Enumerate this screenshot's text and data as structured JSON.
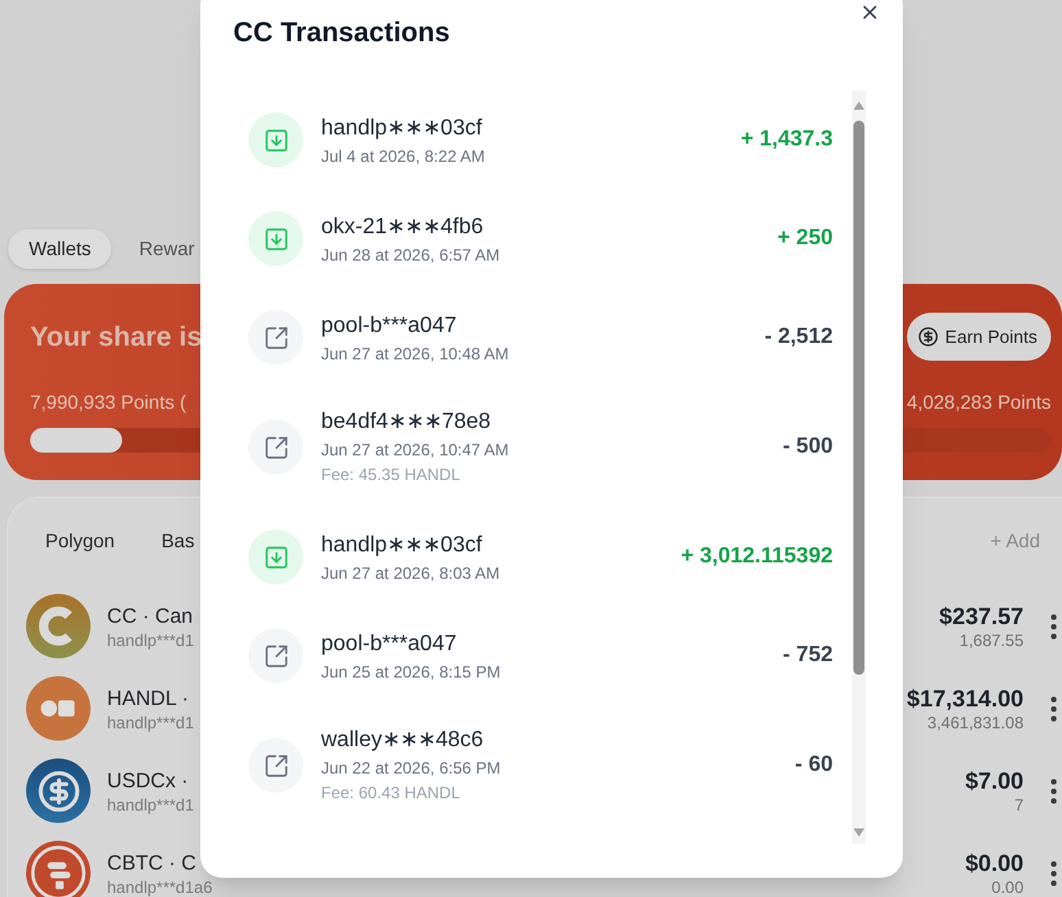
{
  "tabs": [
    {
      "label": "Wallets",
      "selected": true
    },
    {
      "label": "Rewar",
      "selected": false
    }
  ],
  "share_card": {
    "headline": "Your share is",
    "earn_button": "Earn Points",
    "points_left": "7,990,933 Points (",
    "points_right": "4,028,283 Points",
    "level": 0.09
  },
  "assets": {
    "networks": [
      "Polygon",
      "Bas"
    ],
    "add_button": "+ Add",
    "tokens": [
      {
        "kind": "cc",
        "name": "CC · Can",
        "address": "handlp***d1",
        "value": "$237.57",
        "balance": "1,687.55"
      },
      {
        "kind": "handl",
        "name": "HANDL ·",
        "address": "handlp***d1",
        "value": "$17,314.00",
        "balance": "3,461,831.08"
      },
      {
        "kind": "usdcx",
        "name": "USDCx ·",
        "address": "handlp***d1",
        "value": "$7.00",
        "balance": "7"
      },
      {
        "kind": "cbtc",
        "name": "CBTC · C",
        "address": "handlp***d1a6",
        "value": "$0.00",
        "balance": "0.00"
      }
    ]
  },
  "modal": {
    "title": "CC Transactions",
    "transactions": [
      {
        "kind": "in",
        "counterparty": "handlp∗∗∗03cf",
        "date": "Jul 4 at 2026, 8:22 AM",
        "amount": "+ 1,437.3"
      },
      {
        "kind": "in",
        "counterparty": "okx-21∗∗∗4fb6",
        "date": "Jun 28 at 2026, 6:57 AM",
        "amount": "+ 250"
      },
      {
        "kind": "out",
        "counterparty": "pool-b***a047",
        "date": "Jun 27 at 2026, 10:48 AM",
        "amount": "- 2,512"
      },
      {
        "kind": "out",
        "counterparty": "be4df4∗∗∗78e8",
        "date": "Jun 27 at 2026, 10:47 AM",
        "fee": "Fee: 45.35 HANDL",
        "amount": "- 500"
      },
      {
        "kind": "in",
        "counterparty": "handlp∗∗∗03cf",
        "date": "Jun 27 at 2026, 8:03 AM",
        "amount": "+ 3,012.115392"
      },
      {
        "kind": "out",
        "counterparty": "pool-b***a047",
        "date": "Jun 25 at 2026, 8:15 PM",
        "amount": "- 752"
      },
      {
        "kind": "out",
        "counterparty": "walley∗∗∗48c6",
        "date": "Jun 22 at 2026, 6:56 PM",
        "fee": "Fee: 60.43 HANDL",
        "amount": "- 60"
      }
    ]
  }
}
